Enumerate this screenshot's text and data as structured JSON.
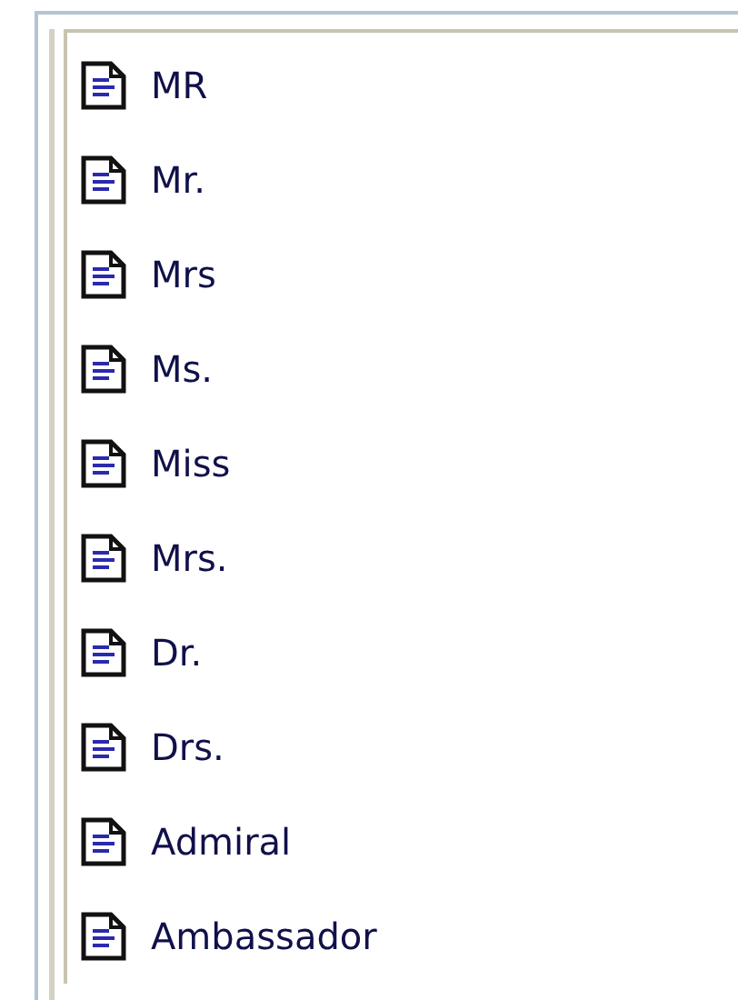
{
  "list": {
    "items": [
      {
        "label": "MR"
      },
      {
        "label": "Mr."
      },
      {
        "label": "Mrs"
      },
      {
        "label": "Ms."
      },
      {
        "label": "Miss"
      },
      {
        "label": "Mrs."
      },
      {
        "label": "Dr."
      },
      {
        "label": "Drs."
      },
      {
        "label": "Admiral"
      },
      {
        "label": "Ambassador"
      }
    ]
  }
}
